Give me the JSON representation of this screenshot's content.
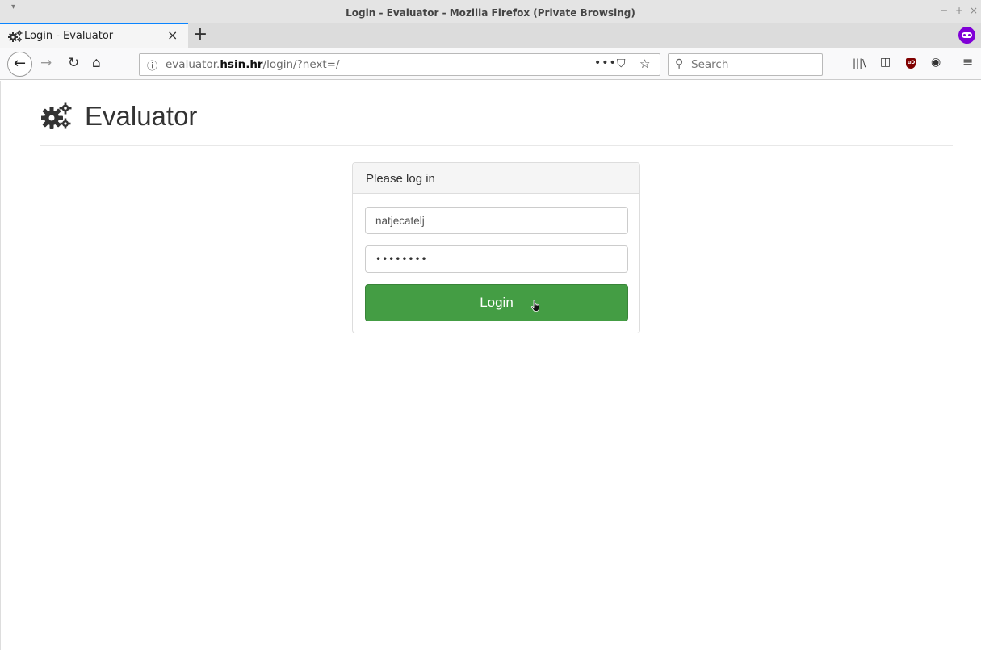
{
  "window": {
    "title": "Login - Evaluator - Mozilla Firefox (Private Browsing)",
    "controls": {
      "minimize": "−",
      "maximize": "+",
      "close": "×"
    },
    "menu_arrow": "▾"
  },
  "tabs": [
    {
      "title": "Login - Evaluator",
      "close": "×",
      "active": true
    }
  ],
  "new_tab_label": "+",
  "nav": {
    "back_glyph": "←",
    "forward_glyph": "→",
    "reload_glyph": "↻",
    "home_glyph": "⌂"
  },
  "url": {
    "info_glyph": "ⓘ",
    "prefix": "evaluator.",
    "domain": "hsin.hr",
    "path": "/login/?next=/",
    "more_glyph": "•••",
    "pocket_glyph": "⛉",
    "star_glyph": "☆"
  },
  "search": {
    "placeholder": "Search",
    "icon_glyph": "⚲"
  },
  "toolbar_icons": {
    "library": "|||\\",
    "sidebar": "◫",
    "ublock": "uD",
    "extension": "◉",
    "menu": "≡"
  },
  "page": {
    "brand_name": "Evaluator",
    "panel_title": "Please log in",
    "username_value": "natjecatelj",
    "password_value": "••••••••",
    "login_label": "Login"
  },
  "colors": {
    "accent_tab": "#0a84ff",
    "private_badge": "#8000d7",
    "login_button": "#449d44",
    "ublock": "#800000"
  }
}
